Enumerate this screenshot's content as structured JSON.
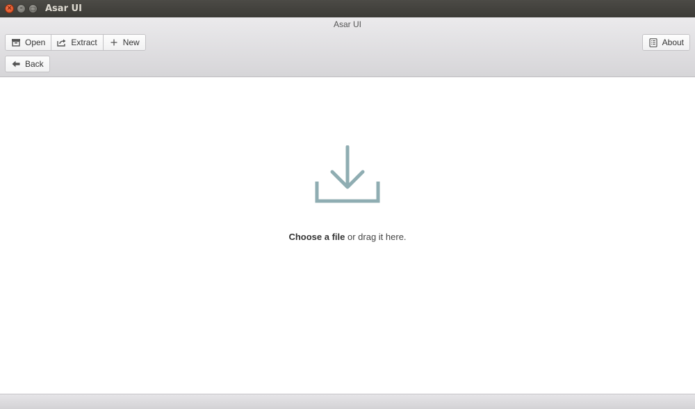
{
  "os_window": {
    "title": "Asar UI",
    "close_glyph": "×",
    "minimize_glyph": "–",
    "maximize_glyph": "□"
  },
  "app": {
    "title": "Asar UI"
  },
  "toolbar": {
    "open_label": "Open",
    "open_icon": "archive-box-icon",
    "extract_label": "Extract",
    "extract_icon": "share-export-icon",
    "new_label": "New",
    "new_icon": "plus-icon",
    "about_label": "About",
    "about_icon": "document-list-icon",
    "back_label": "Back",
    "back_icon": "arrow-left-icon"
  },
  "dropzone": {
    "icon": "download-tray-icon",
    "icon_color": "#8fadb2",
    "choose_text": "Choose a file",
    "drag_text": " or drag it here."
  },
  "colors": {
    "titlebar": "#3e3d39",
    "close_button": "#e5582a",
    "header_bg": "#e3e2e5",
    "accent_icon": "#8fadb2"
  }
}
